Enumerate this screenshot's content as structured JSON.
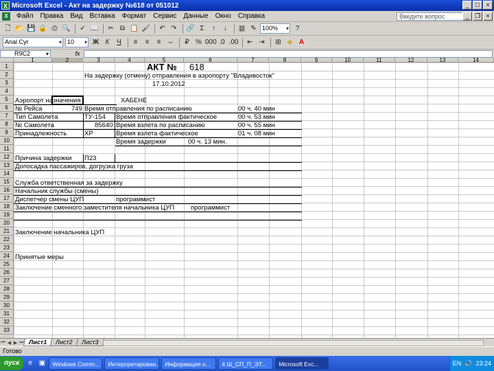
{
  "window": {
    "title": "Microsoft Excel - Акт на задержку №618 от 051012"
  },
  "menu": {
    "items": [
      "Файл",
      "Правка",
      "Вид",
      "Вставка",
      "Формат",
      "Сервис",
      "Данные",
      "Окно",
      "Справка"
    ],
    "help_placeholder": "Введите вопрос"
  },
  "toolbar": {
    "zoom": "100%",
    "font": "Arial Cyr",
    "size": "10"
  },
  "formula": {
    "namebox": "R9C2",
    "fx": "fx",
    "value": ""
  },
  "columns": [
    "1",
    "2",
    "3",
    "4",
    "5",
    "6",
    "7",
    "8",
    "9",
    "10",
    "11",
    "12",
    "13",
    "14"
  ],
  "rows": [
    "1",
    "2",
    "3",
    "4",
    "5",
    "6",
    "7",
    "8",
    "9",
    "10",
    "11",
    "12",
    "13",
    "14",
    "15",
    "16",
    "17",
    "18",
    "19",
    "20",
    "21",
    "22",
    "23",
    "24",
    "25",
    "26",
    "27",
    "28",
    "29",
    "30",
    "31",
    "32",
    "33"
  ],
  "sheet": {
    "act_title": "АКТ №",
    "act_number": "618",
    "subtitle": "На задержку (отмену) отправления в аэропорту \"Владивосток\"",
    "date": "17.10.2012",
    "airport_label": "Аэропорт назначения",
    "airport_value": "ХАБЕНЕ",
    "flight_label": "№ Рейса",
    "flight_value": "749",
    "sched_dep_label": "Время отправления по расписанию",
    "sched_dep_value": "00 ч. 40 мин",
    "type_label": "Тип Самолета",
    "type_value": "ТУ-154",
    "actual_dep_label": "Время отправления фактическое",
    "actual_dep_value": "00 ч. 53 мин",
    "reg_label": "№ Самолета",
    "reg_value": "85640",
    "sched_takeoff_label": "Время взлета по расписанию",
    "sched_takeoff_value": "00 ч. 55 мин",
    "owner_label": "Принадлежность",
    "owner_value": "ХР",
    "actual_takeoff_label": "Время взлета фактическое",
    "actual_takeoff_value": "01 ч. 08 мин",
    "delay_label": "Время задержки",
    "delay_value": "00 ч. 13 мин.",
    "reason_label": "Причина задержки",
    "reason_value": "П23",
    "boarding_label": "Допосадка пассажиров, догрузка груза",
    "responsible_label": "Служба ответственная за задержку",
    "chief_label": "Начальник службы (смены)",
    "dispatcher_label": "Диспетчер смены ЦУП",
    "dispatcher_value": "программист",
    "deputy_label": "Заключение сменного заместителя начальника ЦУП",
    "deputy_value": "программист",
    "chief_conclusion_label": "Заключение начальника ЦУП",
    "measures_label": "Принятые меры"
  },
  "tabs": [
    "Лист1",
    "Лист2",
    "Лист3"
  ],
  "status": "Готово",
  "taskbar": {
    "start": "пуск",
    "tasks": [
      "Windows Comm...",
      "Интерпретирован...",
      "Информация о...",
      "4 Ш_СП_П_ЭТ...",
      "Microsoft Exc..."
    ],
    "tray_lang": "EN",
    "clock": "23:24"
  }
}
